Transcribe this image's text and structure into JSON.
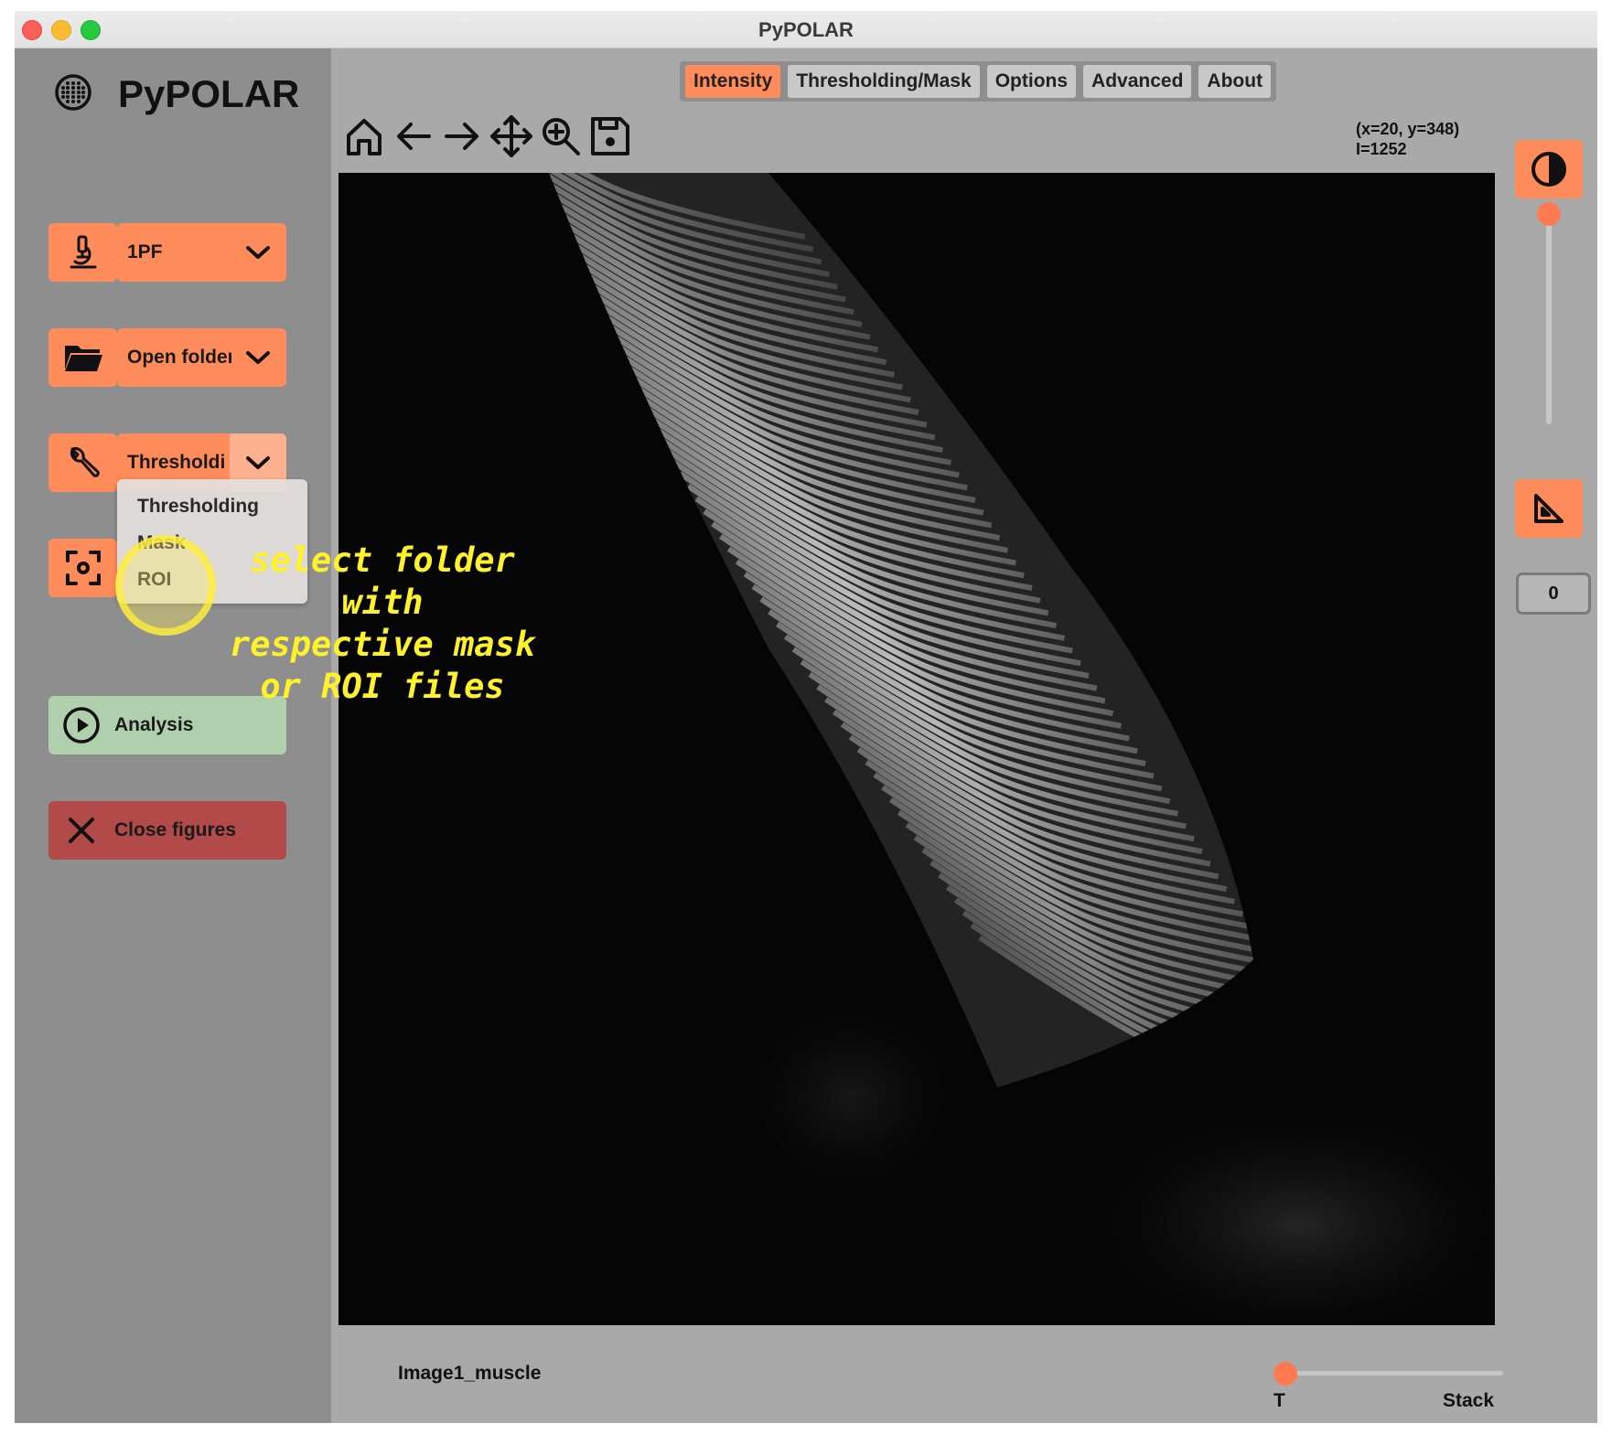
{
  "window": {
    "title": "PyPOLAR"
  },
  "app": {
    "name": "PyPOLAR",
    "logo_icon": "grid-circle-icon"
  },
  "sidebar": {
    "method": {
      "icon": "microscope-icon",
      "value": "1PF"
    },
    "open": {
      "icon": "folder-icon",
      "value": "Open folder"
    },
    "mask_mode": {
      "icon": "wrench-icon",
      "value": "Thresholding"
    },
    "dropdown_options": [
      "Thresholding",
      "Mask",
      "ROI"
    ],
    "roi_button_icon": "focus-frame-icon",
    "analysis": {
      "label": "Analysis",
      "icon": "play-circle-icon"
    },
    "close_figures": {
      "label": "Close figures",
      "icon": "close-icon"
    }
  },
  "annotation": {
    "lines": [
      "select folder with",
      "respective mask",
      "or ROI files"
    ],
    "color": "#fff22a"
  },
  "tabs": [
    {
      "label": "Intensity",
      "active": true
    },
    {
      "label": "Thresholding/Mask",
      "active": false
    },
    {
      "label": "Options",
      "active": false
    },
    {
      "label": "Advanced",
      "active": false
    },
    {
      "label": "About",
      "active": false
    }
  ],
  "toolbar": [
    "home-icon",
    "back-arrow-icon",
    "forward-arrow-icon",
    "pan-icon",
    "zoom-icon",
    "save-icon"
  ],
  "readout": {
    "line1": "(x=20, y=348)",
    "line2": "I=1252"
  },
  "image": {
    "name": "Image1_muscle"
  },
  "stack_slider": {
    "left_label": "T",
    "right_label": "Stack",
    "value_fraction": 0
  },
  "right_panel": {
    "contrast_icon": "contrast-icon",
    "ruler_icon": "set-square-icon",
    "rotation_value": "0",
    "contrast_fraction": 1
  },
  "colors": {
    "accent": "#ff8c5a",
    "analysis": "#b0d0ad",
    "close": "#b14a49",
    "sidebar": "#8e8e8e",
    "background": "#a9a9a9"
  }
}
